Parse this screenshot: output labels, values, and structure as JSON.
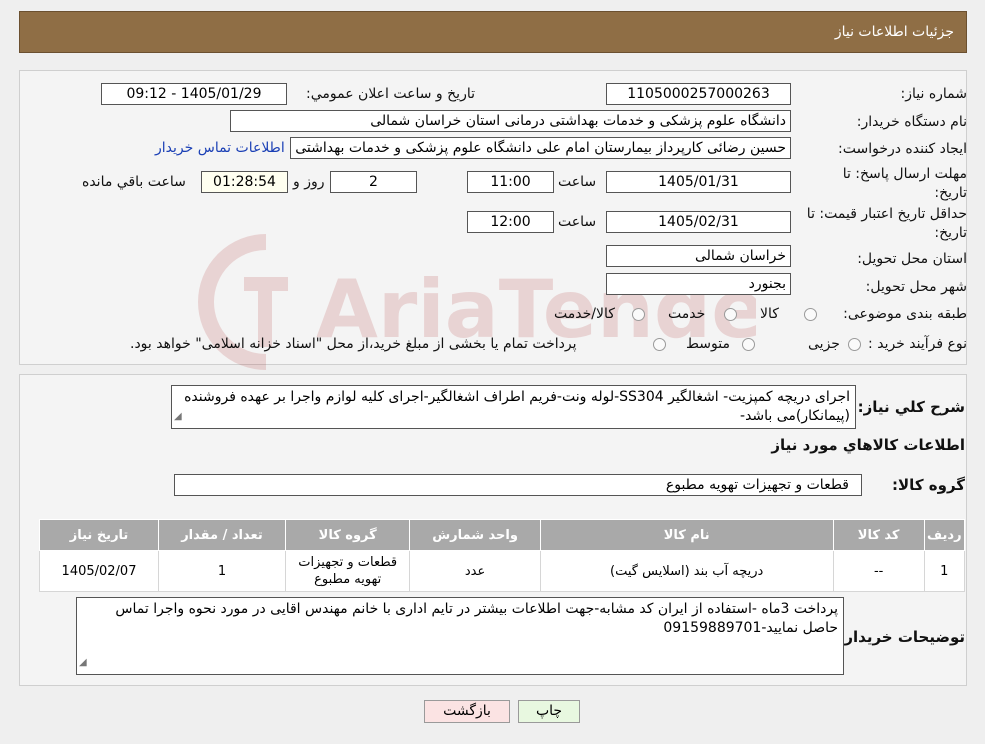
{
  "header": {
    "title": "جزئیات اطلاعات نیاز"
  },
  "form": {
    "need_number_label": "شماره نیاز:",
    "need_number": "1105000257000263",
    "announce_label": "تاریخ و ساعت اعلان عمومي:",
    "announce_value": "1405/01/29 - 09:12",
    "buyer_org_label": "نام دستگاه خریدار:",
    "buyer_org": "دانشگاه علوم پزشکی و خدمات بهداشتی درمانی استان خراسان شمالی",
    "creator_label": "ایجاد کننده درخواست:",
    "creator": "حسین رضائی کارپرداز بیمارستان امام علی دانشگاه علوم پزشکی و خدمات بهداشتی",
    "contact_link": "اطلاعات تماس خریدار",
    "deadline_label_1": "مهلت ارسال پاسخ: تا",
    "deadline_label_2": "تاریخ:",
    "deadline_date": "1405/01/31",
    "time_label": "ساعت",
    "deadline_time": "11:00",
    "days_value": "2",
    "days_label": "روز و",
    "remaining_time": "01:28:54",
    "remaining_label": "ساعت باقي مانده",
    "validity_label_1": "حداقل تاریخ اعتبار قیمت: تا",
    "validity_label_2": "تاریخ:",
    "validity_date": "1405/02/31",
    "validity_time": "12:00",
    "province_label": "استان محل تحویل:",
    "province": "خراسان شمالی",
    "city_label": "شهر محل تحویل:",
    "city": "بجنورد",
    "category_label": "طبقه بندی موضوعی:",
    "category_options": [
      "کالا",
      "خدمت",
      "کالا/خدمت"
    ],
    "process_label": "نوع فرآیند خرید :",
    "process_options": [
      "جزیی",
      "متوسط"
    ],
    "process_note": "پرداخت تمام یا بخشی از مبلغ خرید،از محل \"اسناد خزانه اسلامی\" خواهد بود."
  },
  "description": {
    "label": "شرح کلي نياز:",
    "text": "اجرای دریچه کمپزیت- اشغالگیر SS304-لوله ونت-فریم اطراف اشغالگیر-اجرای کلیه لوازم واجرا بر عهده فروشنده (پیمانکار)می باشد-"
  },
  "goods": {
    "section_title": "اطلاعات کالاهاي مورد نياز",
    "group_label": "گروه کالا:",
    "group_value": "قطعات و تجهیزات تهویه مطبوع",
    "columns": [
      "رديف",
      "کد کالا",
      "نام کالا",
      "واحد شمارش",
      "گروه کالا",
      "تعداد / مقدار",
      "تاریخ نیاز"
    ],
    "rows": [
      [
        "1",
        "--",
        "دریچه آب بند (اسلایس گیت)",
        "عدد",
        "قطعات و تجهیزات تهویه مطبوع",
        "1",
        "1405/02/07"
      ]
    ]
  },
  "notes": {
    "label": "توضیحات خریدار:",
    "text": "پرداخت 3ماه -استفاده از ایران کد مشابه-جهت اطلاعات بیشتر در تایم اداری با خانم مهندس اقایی در مورد نحوه واجرا تماس حاصل نمایید-09159889701"
  },
  "buttons": {
    "print": "چاپ",
    "back": "بازگشت"
  },
  "watermark": {
    "text": "AriaTender.neT"
  },
  "colors": {
    "header": "#8f6e45",
    "link": "#1a3fb5",
    "print_button": "#e8f8e0",
    "back_button": "#fbe3e3"
  }
}
